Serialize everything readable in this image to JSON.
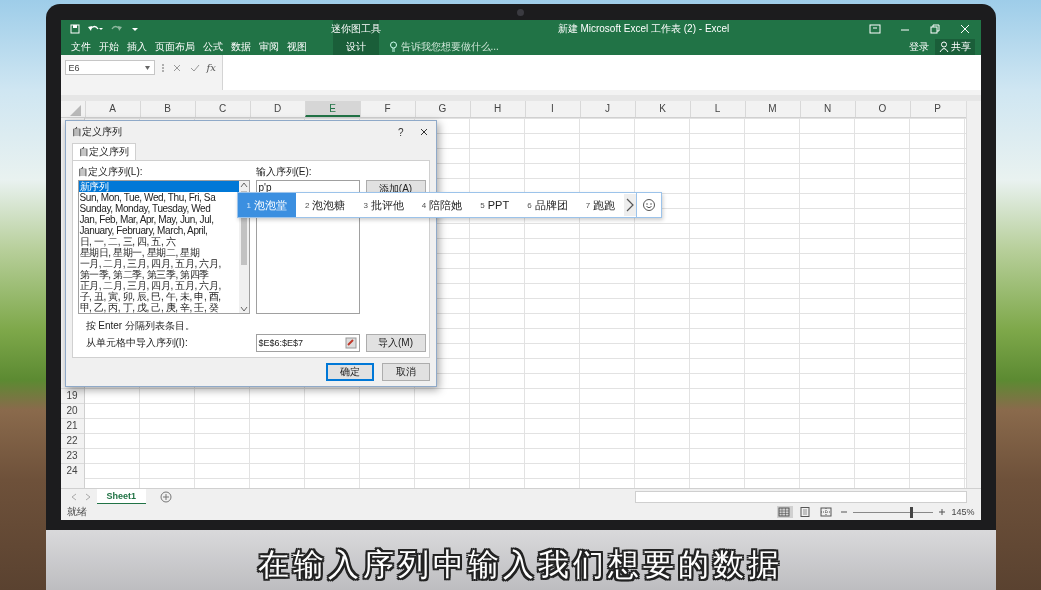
{
  "window": {
    "title": "新建 Microsoft Excel 工作表 (2) - Excel",
    "context_group": "迷你图工具"
  },
  "ribbon": {
    "tabs": [
      {
        "label": "文件",
        "kind": "normal",
        "selected": false
      },
      {
        "label": "开始",
        "kind": "normal",
        "selected": false
      },
      {
        "label": "插入",
        "kind": "normal",
        "selected": false
      },
      {
        "label": "页面布局",
        "kind": "normal",
        "selected": false
      },
      {
        "label": "公式",
        "kind": "normal",
        "selected": false
      },
      {
        "label": "数据",
        "kind": "normal",
        "selected": false
      },
      {
        "label": "审阅",
        "kind": "normal",
        "selected": false
      },
      {
        "label": "视图",
        "kind": "normal",
        "selected": false
      },
      {
        "label": "设计",
        "kind": "contextual",
        "selected": false
      }
    ],
    "tell_me": "告诉我您想要做什么...",
    "sign_in": "登录",
    "share": "共享"
  },
  "formula_bar": {
    "name_box": "E6",
    "function_label": "fx"
  },
  "sheet": {
    "columns": [
      {
        "label": "A",
        "selected": false
      },
      {
        "label": "B",
        "selected": false
      },
      {
        "label": "C",
        "selected": false
      },
      {
        "label": "D",
        "selected": false
      },
      {
        "label": "E",
        "selected": true
      },
      {
        "label": "F",
        "selected": false
      },
      {
        "label": "G",
        "selected": false
      },
      {
        "label": "H",
        "selected": false
      },
      {
        "label": "I",
        "selected": false
      },
      {
        "label": "J",
        "selected": false
      },
      {
        "label": "K",
        "selected": false
      },
      {
        "label": "L",
        "selected": false
      },
      {
        "label": "M",
        "selected": false
      },
      {
        "label": "N",
        "selected": false
      },
      {
        "label": "O",
        "selected": false
      },
      {
        "label": "P",
        "selected": false
      }
    ],
    "rows": [
      "19",
      "20",
      "21",
      "22",
      "23",
      "24"
    ]
  },
  "dialog": {
    "title": "自定义序列",
    "help": "?",
    "tabs": [
      {
        "label": "自定义序列",
        "selected": true
      }
    ],
    "list_label": "自定义序列(L):",
    "list_items": [
      {
        "text": "新序列",
        "selected": true
      },
      {
        "text": "Sun, Mon, Tue, Wed, Thu, Fri, Sa",
        "selected": false
      },
      {
        "text": "Sunday, Monday, Tuesday, Wed",
        "selected": false
      },
      {
        "text": "Jan, Feb, Mar, Apr, May, Jun, Jul,",
        "selected": false
      },
      {
        "text": "January, February, March, April,",
        "selected": false
      },
      {
        "text": "日, 一, 二, 三, 四, 五, 六",
        "selected": false
      },
      {
        "text": "星期日, 星期一, 星期二, 星期",
        "selected": false
      },
      {
        "text": "一月, 二月, 三月, 四月, 五月, 六月,",
        "selected": false
      },
      {
        "text": "第一季, 第二季, 第三季, 第四季",
        "selected": false
      },
      {
        "text": "正月, 二月, 三月, 四月, 五月, 六月,",
        "selected": false
      },
      {
        "text": "子, 丑, 寅, 卯, 辰, 巳, 午, 未, 申, 酉,",
        "selected": false
      },
      {
        "text": "甲, 乙, 丙, 丁, 戊, 己, 庚, 辛, 壬, 癸",
        "selected": false
      }
    ],
    "entries_label": "输入序列(E):",
    "entries_value": "p'p",
    "add_button": "添加(A)",
    "hint": "按 Enter 分隔列表条目。",
    "import_label": "从单元格中导入序列(I):",
    "import_value": "$E$6:$E$7",
    "import_button": "导入(M)",
    "buttons": [
      {
        "label": "确定",
        "default": true
      },
      {
        "label": "取消",
        "default": false
      }
    ]
  },
  "ime": {
    "candidates": [
      {
        "index": "1",
        "text": "泡泡堂",
        "selected": true
      },
      {
        "index": "2",
        "text": "泡泡糖",
        "selected": false
      },
      {
        "index": "3",
        "text": "批评他",
        "selected": false
      },
      {
        "index": "4",
        "text": "陪陪她",
        "selected": false
      },
      {
        "index": "5",
        "text": "PPT",
        "selected": false
      },
      {
        "index": "6",
        "text": "品牌团",
        "selected": false
      },
      {
        "index": "7",
        "text": "跑跑",
        "selected": false
      }
    ]
  },
  "sheet_tabs": [
    {
      "label": "Sheet1",
      "selected": true
    }
  ],
  "status_bar": {
    "text": "就绪",
    "views": [
      {
        "kind": "normal",
        "selected": true
      },
      {
        "kind": "page_layout",
        "selected": false
      },
      {
        "kind": "page_break",
        "selected": false
      }
    ],
    "zoom": {
      "level": 0.72,
      "reading": "145%"
    }
  },
  "caption": "在输入序列中输入我们想要的数据"
}
